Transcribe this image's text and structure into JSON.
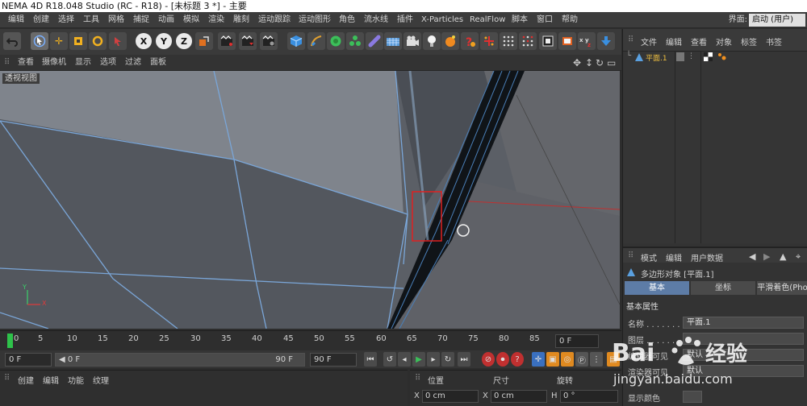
{
  "window": {
    "title": "NEMA 4D R18.048 Studio (RC - R18) - [未标题 3 *] - 主要"
  },
  "menubar": {
    "items": [
      "编辑",
      "创建",
      "选择",
      "工具",
      "网格",
      "捕捉",
      "动画",
      "模拟",
      "渲染",
      "雕刻",
      "运动跟踪",
      "运动图形",
      "角色",
      "流水线",
      "插件",
      "X-Particles",
      "RealFlow",
      "脚本",
      "窗口",
      "帮助"
    ],
    "interface_label": "界面:",
    "interface_value": "启动 (用户)"
  },
  "toolbar": {
    "axis_x": "X",
    "axis_y": "Y",
    "axis_z": "Z"
  },
  "viewport_menu": {
    "items": [
      "查看",
      "摄像机",
      "显示",
      "选项",
      "过滤",
      "面板"
    ]
  },
  "viewport": {
    "label": "透视视图",
    "axis_x": "X",
    "axis_y": "Y",
    "highlight_color": "#e02020",
    "wire_color": "#7aa6d8"
  },
  "timeline": {
    "ticks": [
      "0",
      "5",
      "10",
      "15",
      "20",
      "25",
      "30",
      "35",
      "40",
      "45",
      "50",
      "55",
      "60",
      "65",
      "70",
      "75",
      "80",
      "85",
      "90"
    ],
    "end_frame": "0 F"
  },
  "playbar": {
    "current": "0 F",
    "range_start": "◀ 0 F",
    "range_end": "90 F",
    "max": "90 F"
  },
  "bottom_left": {
    "items": [
      "创建",
      "编辑",
      "功能",
      "纹理"
    ]
  },
  "coords": {
    "headers": [
      "位置",
      "尺寸",
      "旋转"
    ],
    "row": [
      {
        "axis": "X",
        "value": "0 cm"
      },
      {
        "axis": "X",
        "value": "0 cm"
      },
      {
        "axis": "H",
        "value": "0 °"
      }
    ]
  },
  "object_manager": {
    "menu": [
      "文件",
      "编辑",
      "查看",
      "对象",
      "标签",
      "书签"
    ],
    "object_name": "平面.1"
  },
  "attribute_manager": {
    "menu": [
      "模式",
      "编辑",
      "用户数据"
    ],
    "title": "多边形对象 [平面.1]",
    "tabs": [
      "基本",
      "坐标",
      "平滑着色(Pho"
    ],
    "section": "基本属性",
    "props": [
      {
        "label": "名称 . . . . . . .",
        "value": "平面.1"
      },
      {
        "label": "图层 . . . . . . .",
        "value": ""
      },
      {
        "label": "编辑器可见",
        "value": "默认"
      },
      {
        "label": "渲染器可见",
        "value": "默认"
      },
      {
        "label": "显示颜色",
        "value": ""
      }
    ]
  },
  "watermark": {
    "brand": "Bai",
    "brand2": "经验",
    "url": "jingyan.baidu.com"
  }
}
